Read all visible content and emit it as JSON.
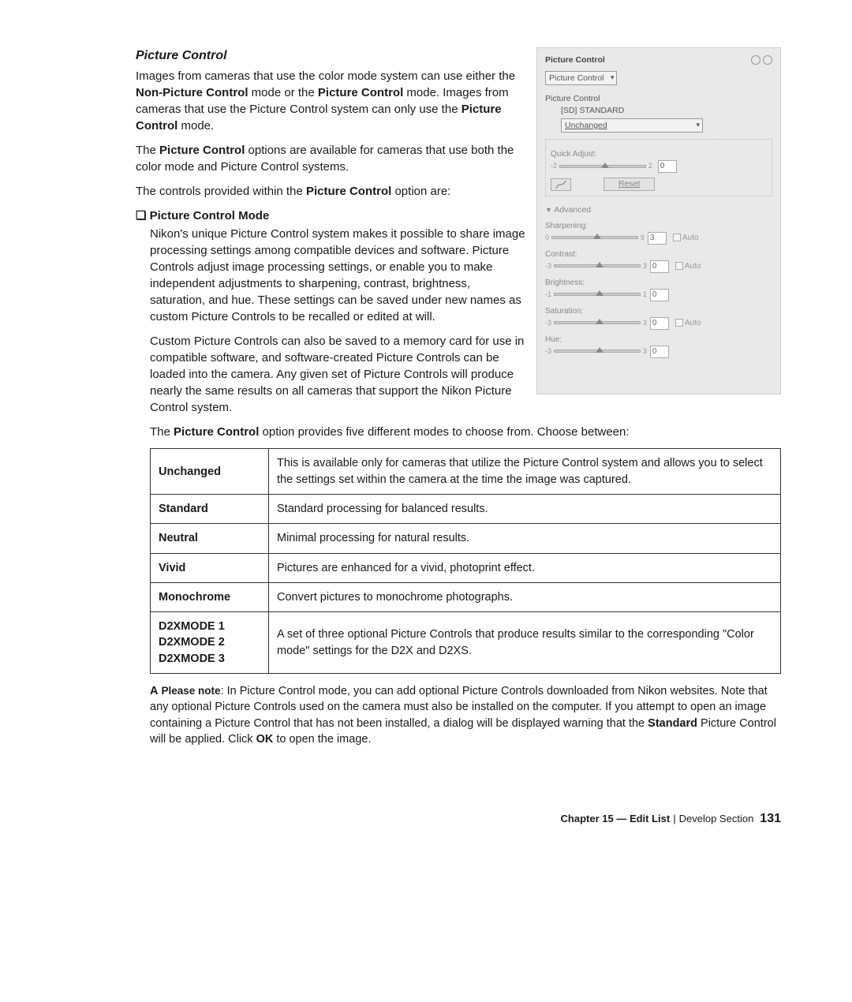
{
  "title": "Picture Control",
  "intro1_a": "Images from cameras that use the color mode system can use either the ",
  "intro1_b": " mode or the ",
  "intro1_c": " mode. Images from cameras that use the Picture Control system can only use the ",
  "intro1_d": " mode.",
  "term_nonpc": "Non-Picture Control",
  "term_pc": "Picture Control",
  "intro2_a": "The ",
  "intro2_b": " options are available for cameras that use both the color mode and Picture Control systems.",
  "intro3_a": "The controls provided within the ",
  "intro3_b": " option are:",
  "sub_mode_title": "Picture Control Mode",
  "sub_mode_bullet": "❏",
  "mode_p1": "Nikon's unique Picture Control system makes it possible to share image processing settings among compatible devices and software. Picture Controls adjust image processing settings, or enable you to make independent adjustments to sharpening, contrast, brightness, saturation, and hue. These settings can be saved under new names as custom Picture Controls to be recalled or edited at will.",
  "mode_p2": "Custom Picture Controls can also be saved to a memory card for use in compatible software, and software-created Picture Controls can be loaded into the camera. Any given set of Picture Controls will produce nearly the same results on all cameras that support the Nikon Picture Control system.",
  "mode_p3_a": "The ",
  "mode_p3_b": " option provides five different modes to choose from. Choose between:",
  "table": [
    {
      "k": "Unchanged",
      "v": "This is available only for cameras that utilize the Picture Control system and allows you to select the settings set within the camera at the time the image was captured."
    },
    {
      "k": "Standard",
      "v": "Standard processing for balanced results."
    },
    {
      "k": "Neutral",
      "v": "Minimal processing for natural results."
    },
    {
      "k": "Vivid",
      "v": "Pictures are enhanced for a vivid, photoprint effect."
    },
    {
      "k": "Monochrome",
      "v": "Convert pictures to monochrome photographs."
    },
    {
      "k": "D2XMODE 1\nD2XMODE 2\nD2XMODE 3",
      "v": "A set of three optional Picture Controls that produce results similar to the corresponding \"Color mode\" settings for the D2X and D2XS."
    }
  ],
  "note": {
    "icon": "A",
    "lead": "Please note",
    "a": ": In Picture Control mode, you can add optional Picture Controls downloaded from Nikon websites. Note that any optional Picture Controls used on the camera must also be installed on the computer. If you attempt to open an image containing a Picture Control that has not been installed, a dialog will be displayed warning that the ",
    "std": "Standard",
    "b": " Picture Control will be applied. Click ",
    "ok": "OK",
    "c": " to open the image."
  },
  "panel": {
    "title": "Picture Control",
    "mode_dd": "Picture Control",
    "group_label": "Picture Control",
    "preset": "[SD] STANDARD",
    "preset_dd": "Unchanged",
    "quick_adjust": "Quick Adjust:",
    "qa_min": "-2",
    "qa_max": "2",
    "qa_val": "0",
    "reset": "Reset",
    "advanced": "Advanced",
    "auto": "Auto",
    "sliders": [
      {
        "label": "Sharpening:",
        "min": "0",
        "max": "9",
        "val": "3",
        "hasAuto": true
      },
      {
        "label": "Contrast:",
        "min": "-3",
        "max": "3",
        "val": "0",
        "hasAuto": true
      },
      {
        "label": "Brightness:",
        "min": "-1",
        "max": "1",
        "val": "0",
        "hasAuto": false
      },
      {
        "label": "Saturation:",
        "min": "-3",
        "max": "3",
        "val": "0",
        "hasAuto": true
      },
      {
        "label": "Hue:",
        "min": "-3",
        "max": "3",
        "val": "0",
        "hasAuto": false
      }
    ]
  },
  "footer": {
    "chapter": "Chapter 15 — Edit List",
    "section": "Develop Section",
    "page": "131"
  }
}
